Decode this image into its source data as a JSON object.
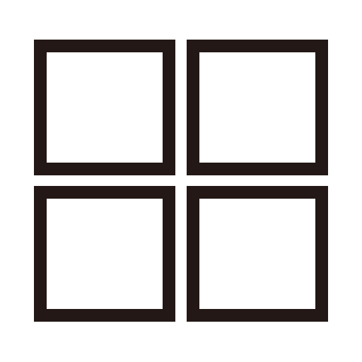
{
  "icon": {
    "name": "grid-view-icon",
    "cells": 4,
    "stroke_color": "#231815",
    "background_color": "#ffffff"
  }
}
